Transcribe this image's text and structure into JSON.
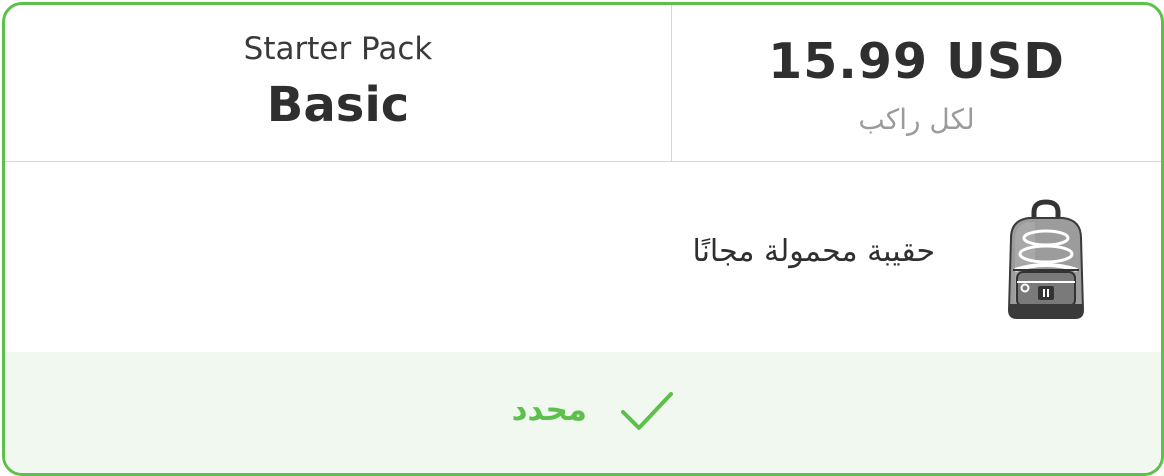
{
  "plan": {
    "subtitle": "Starter Pack",
    "name": "Basic"
  },
  "price": {
    "amount": "15.99 USD",
    "per_unit": "لكل راكب"
  },
  "feature": {
    "text": "حقيبة محمولة مجانًا",
    "icon": "backpack-icon"
  },
  "status": {
    "label": "محدد",
    "icon": "checkmark-icon"
  },
  "colors": {
    "accent": "#5cc04a",
    "selected_background": "#f1f8ef",
    "divider": "#d6d6d6",
    "primary_text": "#2f2f2f",
    "secondary_text": "#9b9b9b"
  }
}
